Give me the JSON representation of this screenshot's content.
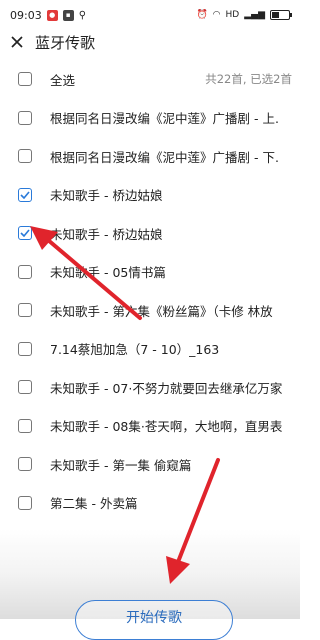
{
  "status_bar": {
    "time": "09:03",
    "network": "HD"
  },
  "header": {
    "title": "蓝牙传歌"
  },
  "select_all": {
    "label": "全选",
    "summary": "共22首, 已选2首"
  },
  "songs": [
    {
      "title": "根据同名日漫改编《泥中莲》广播剧 - 上.",
      "checked": false
    },
    {
      "title": "根据同名日漫改编《泥中莲》广播剧 - 下.",
      "checked": false
    },
    {
      "title": "未知歌手 - 桥边姑娘",
      "checked": true
    },
    {
      "title": "未知歌手 - 桥边姑娘",
      "checked": true
    },
    {
      "title": "未知歌手 - 05情书篇",
      "checked": false
    },
    {
      "title": "未知歌手 - 第六集《粉丝篇》（卡修 林放",
      "checked": false
    },
    {
      "title": "7.14蔡旭加急（7 - 10）_163",
      "checked": false
    },
    {
      "title": "未知歌手 - 07·不努力就要回去继承亿万家",
      "checked": false
    },
    {
      "title": "未知歌手 - 08集·苍天啊，大地啊，直男表",
      "checked": false
    },
    {
      "title": "未知歌手 - 第一集 偷窥篇",
      "checked": false
    },
    {
      "title": "第二集 - 外卖篇",
      "checked": false
    }
  ],
  "footer": {
    "start_label": "开始传歌"
  },
  "colors": {
    "accent": "#2a7ad9",
    "annotation_arrow": "#e0242c"
  }
}
